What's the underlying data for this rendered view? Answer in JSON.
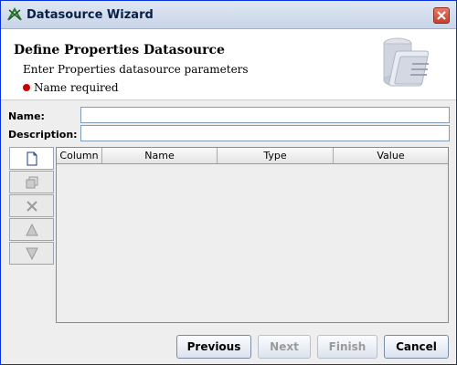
{
  "window": {
    "title": "Datasource Wizard"
  },
  "header": {
    "title": "Define Properties Datasource",
    "subtitle": "Enter Properties datasource parameters",
    "error": "Name required"
  },
  "form": {
    "name_label": "Name:",
    "name_value": "",
    "description_label": "Description:",
    "description_value": ""
  },
  "toolbar": {
    "buttons": [
      "new-row-icon",
      "copy-row-icon",
      "delete-row-icon",
      "move-up-icon",
      "move-down-icon"
    ]
  },
  "table": {
    "columns": [
      "Column",
      "Name",
      "Type",
      "Value"
    ],
    "rows": []
  },
  "buttons": {
    "previous": "Previous",
    "next": "Next",
    "finish": "Finish",
    "cancel": "Cancel"
  },
  "colors": {
    "title_blue": "#0a1f46",
    "error_red": "#cc0000",
    "field_border": "#7f9db9"
  }
}
